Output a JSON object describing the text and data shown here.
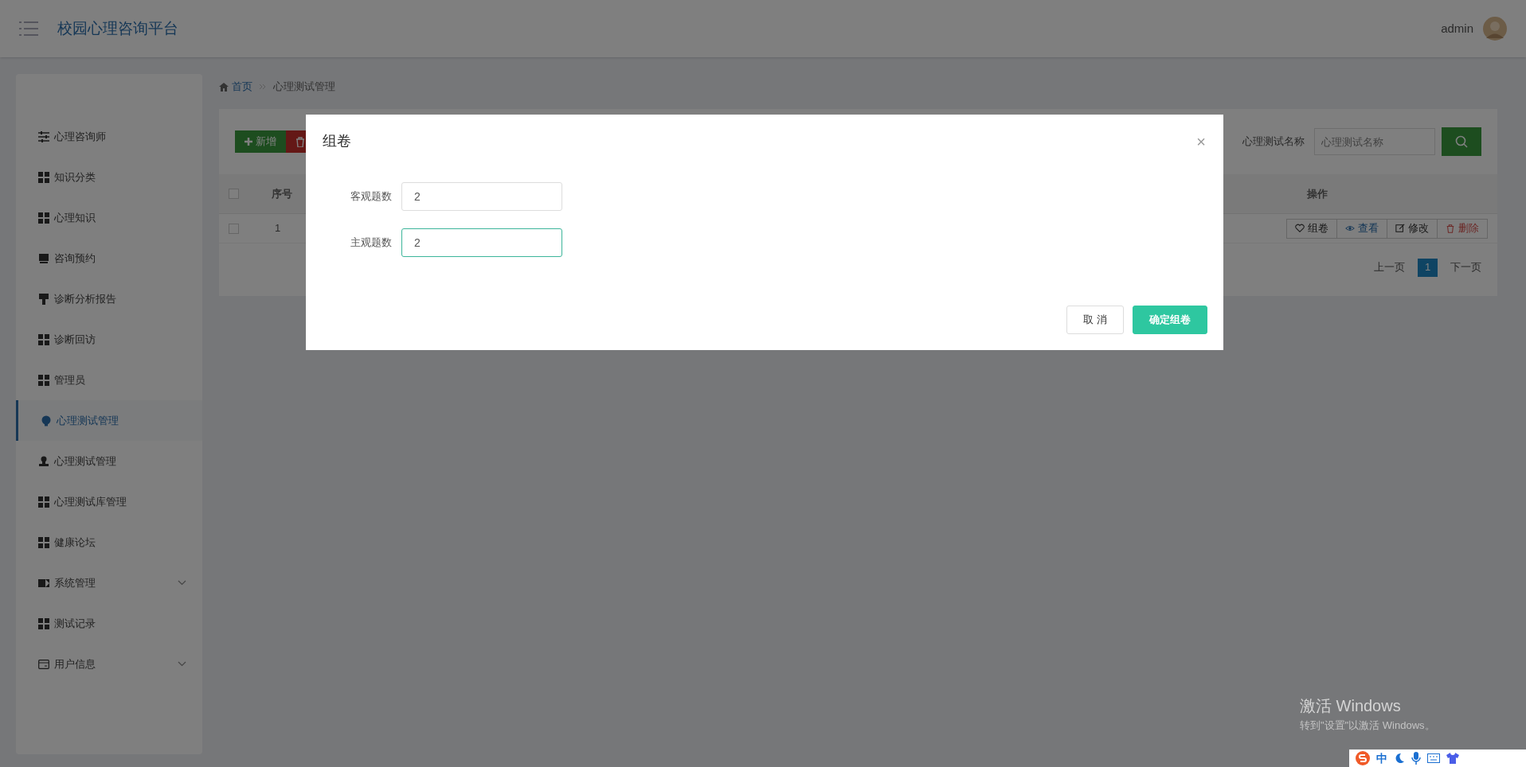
{
  "header": {
    "title": "校园心理咨询平台",
    "user": "admin"
  },
  "sidebar": {
    "items": [
      {
        "label": "心理咨询师",
        "selected": false,
        "has_submenu": false
      },
      {
        "label": "知识分类",
        "selected": false,
        "has_submenu": false
      },
      {
        "label": "心理知识",
        "selected": false,
        "has_submenu": false
      },
      {
        "label": "咨询预约",
        "selected": false,
        "has_submenu": false
      },
      {
        "label": "诊断分析报告",
        "selected": false,
        "has_submenu": false
      },
      {
        "label": "诊断回访",
        "selected": false,
        "has_submenu": false
      },
      {
        "label": "管理员",
        "selected": false,
        "has_submenu": false
      },
      {
        "label": "心理测试管理",
        "selected": true,
        "has_submenu": false
      },
      {
        "label": "心理测试管理",
        "selected": false,
        "has_submenu": false
      },
      {
        "label": "心理测试库管理",
        "selected": false,
        "has_submenu": false
      },
      {
        "label": "健康论坛",
        "selected": false,
        "has_submenu": false
      },
      {
        "label": "系统管理",
        "selected": false,
        "has_submenu": true
      },
      {
        "label": "测试记录",
        "selected": false,
        "has_submenu": false
      },
      {
        "label": "用户信息",
        "selected": false,
        "has_submenu": true
      }
    ]
  },
  "breadcrumb": [
    {
      "label": "首页",
      "link": true
    },
    {
      "label": "心理测试管理",
      "link": false
    }
  ],
  "toolbar": {
    "add_button": "新增",
    "search_label": "心理测试名称",
    "search_placeholder": "心理测试名称"
  },
  "table": {
    "columns": [
      "序号",
      "操作"
    ],
    "select_all_checked": false,
    "rows": [
      {
        "checked": false,
        "index": "1",
        "actions": [
          {
            "kind": "compose",
            "label": "组卷"
          },
          {
            "kind": "view",
            "label": "查看"
          },
          {
            "kind": "edit",
            "label": "修改"
          },
          {
            "kind": "delete",
            "label": "删除"
          }
        ]
      }
    ]
  },
  "pagination": {
    "prev": "上一页",
    "pages": [
      {
        "label": "1",
        "selected": true
      }
    ],
    "next": "下一页"
  },
  "modal": {
    "title": "组卷",
    "close": "×",
    "fields": [
      {
        "label": "客观题数",
        "value": "2",
        "focused": false
      },
      {
        "label": "主观题数",
        "value": "2",
        "focused": true
      }
    ],
    "buttons": [
      {
        "kind": "secondary",
        "label": "取 消"
      },
      {
        "kind": "primary",
        "label": "确定组卷"
      }
    ]
  },
  "activation": {
    "title": "激活 Windows",
    "subtitle": "转到\"设置\"以激活 Windows。"
  },
  "ime": {
    "mode": "中"
  }
}
